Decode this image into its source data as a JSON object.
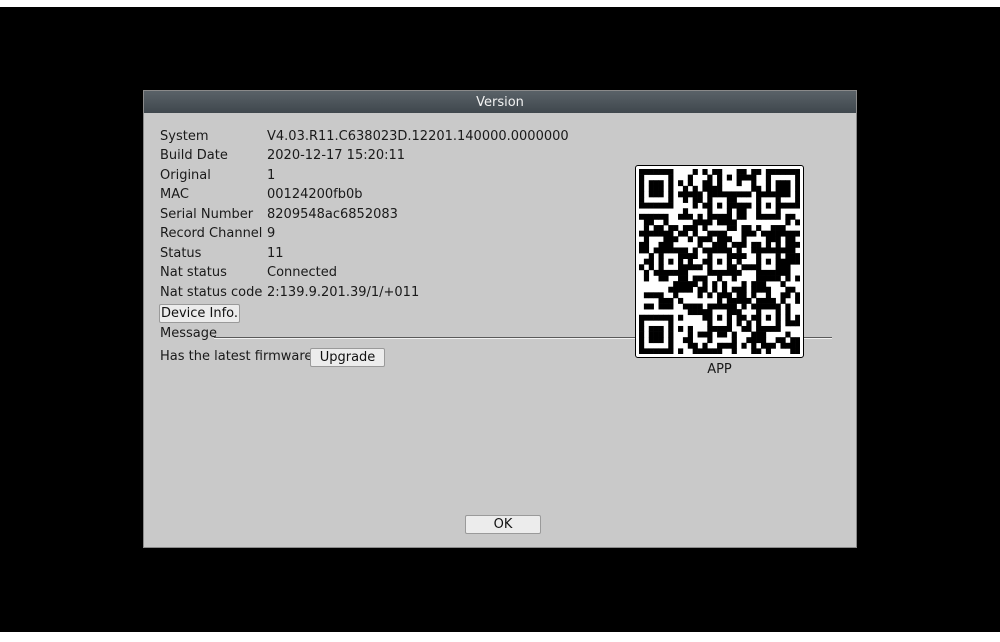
{
  "dialog": {
    "title": "Version"
  },
  "info": [
    {
      "label": "System",
      "value": "V4.03.R11.C638023D.12201.140000.0000000"
    },
    {
      "label": "Build Date",
      "value": "2020-12-17 15:20:11"
    },
    {
      "label": "Original",
      "value": "1"
    },
    {
      "label": "MAC",
      "value": "00124200fb0b"
    },
    {
      "label": "Serial Number",
      "value": "8209548ac6852083"
    },
    {
      "label": "Record Channel",
      "value": "9"
    },
    {
      "label": "Status",
      "value": "11"
    },
    {
      "label": "Nat status",
      "value": "Connected"
    },
    {
      "label": "Nat status code",
      "value": "2:139.9.201.39/1/+011"
    }
  ],
  "buttons": {
    "device_info": "Device Info.",
    "upgrade": "Upgrade",
    "ok": "OK"
  },
  "message": {
    "label": "Message",
    "firmware_status": "Has the latest firmware"
  },
  "qr": {
    "caption": "APP"
  },
  "colors": {
    "background": "#000000",
    "dialog_bg": "#c9c9c9",
    "titlebar": "#4a5258"
  }
}
